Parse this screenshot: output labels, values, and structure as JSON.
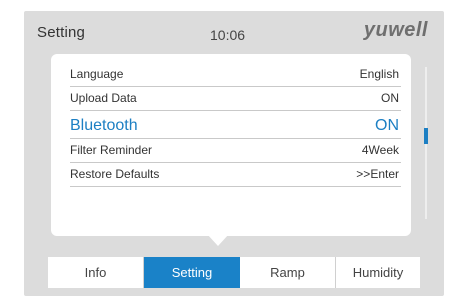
{
  "header": {
    "title": "Setting",
    "time": "10:06",
    "brand": "yuwell"
  },
  "settings": {
    "items": [
      {
        "label": "Language",
        "value": "English"
      },
      {
        "label": "Upload Data",
        "value": "ON"
      },
      {
        "label": "Bluetooth",
        "value": "ON"
      },
      {
        "label": "Filter Reminder",
        "value": "4Week"
      },
      {
        "label": "Restore Defaults",
        "value": ">>Enter"
      }
    ],
    "selected_index": 2
  },
  "tabs": [
    {
      "label": "Info"
    },
    {
      "label": "Setting"
    },
    {
      "label": "Ramp"
    },
    {
      "label": "Humidity"
    }
  ],
  "active_tab": "Setting",
  "colors": {
    "accent": "#1c7fc3",
    "screen_background": "#dcdcdc",
    "panel_background": "#ffffff"
  }
}
